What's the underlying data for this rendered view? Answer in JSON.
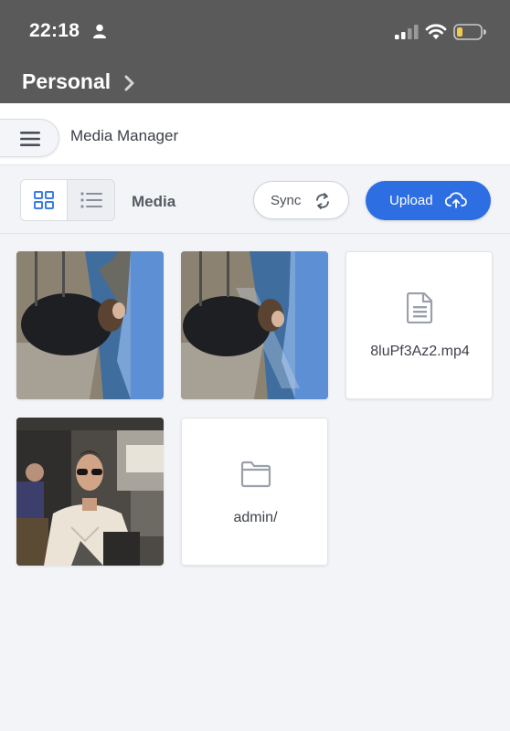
{
  "status_bar": {
    "time": "22:18",
    "icons": [
      "person-icon",
      "cellular-signal-icon",
      "wifi-icon",
      "battery-low-icon"
    ],
    "battery_color": "#f2c94c"
  },
  "nav": {
    "title": "Personal",
    "chevron_icon": "chevron-right-icon"
  },
  "app": {
    "menu_icon": "hamburger-menu-icon",
    "title": "Media Manager"
  },
  "toolbar": {
    "view_modes": [
      {
        "name": "grid",
        "icon": "grid-view-icon",
        "active": true
      },
      {
        "name": "list",
        "icon": "list-view-icon",
        "active": false
      }
    ],
    "section_label": "Media",
    "sync_label": "Sync",
    "sync_icon": "refresh-icon",
    "upload_label": "Upload",
    "upload_icon": "cloud-upload-icon",
    "accent_color": "#2e6ee3"
  },
  "media": {
    "items": [
      {
        "type": "image",
        "description": "person on a viewpoint above a lake, rotated"
      },
      {
        "type": "image",
        "description": "person on a viewpoint above a lake, rotated"
      },
      {
        "type": "video",
        "label": "8luPf3Az2.mp4",
        "icon": "file-document-icon"
      },
      {
        "type": "image",
        "description": "man in white sweater and sunglasses at a cafe"
      },
      {
        "type": "folder",
        "label": "admin/",
        "icon": "folder-icon"
      }
    ]
  }
}
